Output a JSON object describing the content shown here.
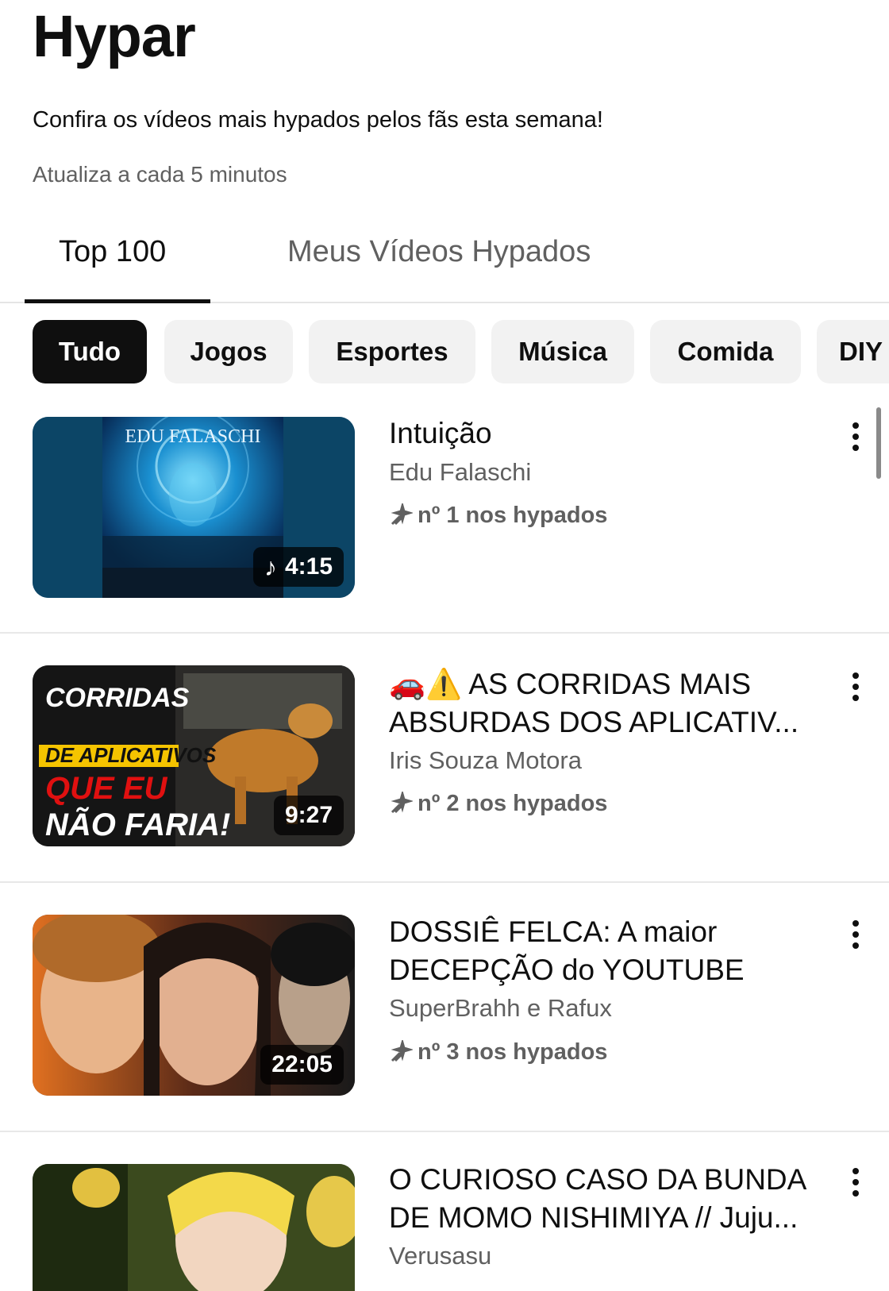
{
  "header": {
    "title": "Hypar",
    "subtitle": "Confira os vídeos mais hypados pelos fãs esta semana!",
    "note": "Atualiza a cada 5 minutos"
  },
  "tabs": [
    {
      "label": "Top 100",
      "active": true
    },
    {
      "label": "Meus Vídeos Hypados",
      "active": false
    }
  ],
  "chips": [
    {
      "label": "Tudo",
      "active": true
    },
    {
      "label": "Jogos"
    },
    {
      "label": "Esportes"
    },
    {
      "label": "Música"
    },
    {
      "label": "Comida"
    },
    {
      "label": "DIY"
    }
  ],
  "videos": [
    {
      "title": "Intuição",
      "channel": "Edu Falaschi",
      "rank": "nº 1 nos hypados",
      "duration": "4:15",
      "music": true,
      "thumb_text": [
        "EDU FALASCHI"
      ]
    },
    {
      "title": "🚗⚠️ AS CORRIDAS MAIS ABSURDAS DOS APLICATIV...",
      "channel": "Iris Souza Motora",
      "rank": "nº 2 nos hypados",
      "duration": "9:27",
      "thumb_text": [
        "CORRIDAS",
        "DE APLICATIVOS",
        "QUE EU",
        "NÃO FARIA!"
      ]
    },
    {
      "title": "DOSSIÊ FELCA: A maior DECEPÇÃO do YOUTUBE",
      "channel": "SuperBrahh e Rafux",
      "rank": "nº 3 nos hypados",
      "duration": "22:05"
    },
    {
      "title": "O CURIOSO CASO DA BUNDA DE MOMO NISHIMIYA // Juju...",
      "channel": "Verusasu"
    }
  ],
  "colors": {
    "text": "#0f0f0f",
    "secondary": "#606060",
    "chip_bg": "#f2f2f2",
    "chip_active_bg": "#0f0f0f"
  },
  "icons": {
    "more": "kebab-menu-icon",
    "rank": "hype-sparkle-icon",
    "music": "music-note-icon"
  }
}
